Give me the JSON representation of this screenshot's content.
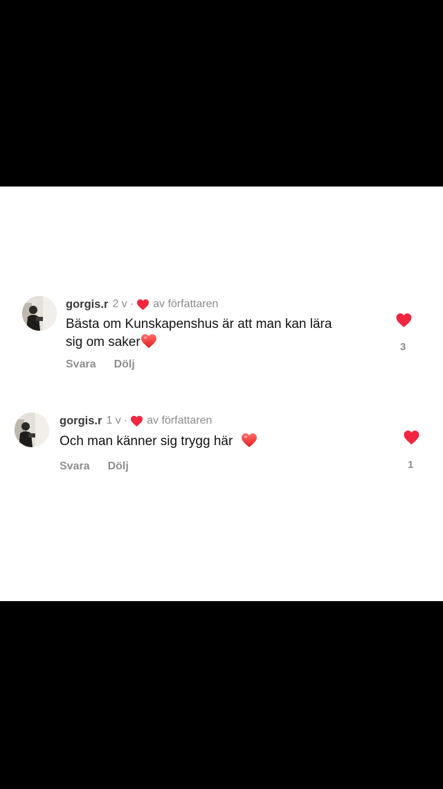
{
  "colors": {
    "heart": "#f0253f",
    "background": "#ffffff",
    "frame": "#000000"
  },
  "comments": [
    {
      "username": "gorgis.r",
      "age": "2 v",
      "separator": "·",
      "author_label": "av författaren",
      "text_line1": "Bästa om Kunskapenshus är att man kan lära",
      "text_line2": "sig om saker",
      "text_emoji": "heart",
      "reply_label": "Svara",
      "hide_label": "Dölj",
      "like_count": "3",
      "liked": true
    },
    {
      "username": "gorgis.r",
      "age": "1 v",
      "separator": "·",
      "author_label": "av författaren",
      "text_line1": "Och man känner sig trygg här",
      "text_emoji": "heart",
      "reply_label": "Svara",
      "hide_label": "Dölj",
      "like_count": "1",
      "liked": true
    }
  ]
}
